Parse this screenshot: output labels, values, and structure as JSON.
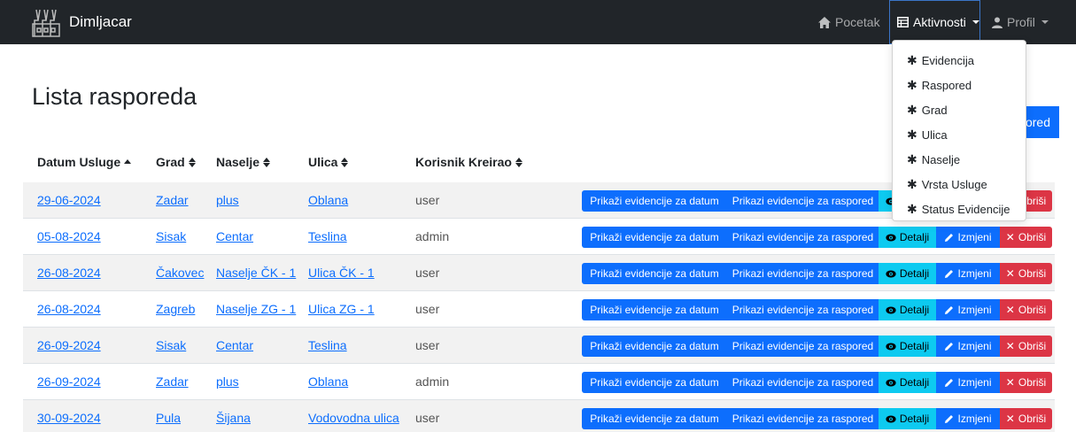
{
  "navbar": {
    "brand": "Dimljacar",
    "home_label": "Pocetak",
    "activities_label": "Aktivnosti",
    "profile_label": "Profil"
  },
  "dropdown": {
    "items": [
      {
        "icon": "asterisk-icon",
        "label": "Evidencija"
      },
      {
        "icon": "asterisk-icon",
        "label": "Raspored"
      },
      {
        "icon": "asterisk-icon",
        "label": "Grad"
      },
      {
        "icon": "asterisk-icon",
        "label": "Ulica"
      },
      {
        "icon": "asterisk-icon",
        "label": "Naselje"
      },
      {
        "icon": "asterisk-icon",
        "label": "Vrsta Usluge"
      },
      {
        "icon": "asterisk-icon",
        "label": "Status Evidencije"
      }
    ]
  },
  "page": {
    "title": "Lista rasporeda",
    "add_button_partial": "ored"
  },
  "table": {
    "headers": [
      "Datum Usluge",
      "Grad",
      "Naselje",
      "Ulica",
      "Korisnik Kreirao"
    ],
    "buttons": {
      "by_date": "Prikaži evidencije za datum",
      "by_schedule": "Prikazi evidencije za raspored",
      "details": "Detalji",
      "edit": "Izmjeni",
      "delete": "Obriši"
    },
    "rows": [
      {
        "datum": "29-06-2024",
        "grad": "Zadar",
        "naselje": "plus",
        "ulica": "Oblana",
        "korisnik": "user"
      },
      {
        "datum": "05-08-2024",
        "grad": "Sisak",
        "naselje": "Centar",
        "ulica": "Teslina",
        "korisnik": "admin"
      },
      {
        "datum": "26-08-2024",
        "grad": "Čakovec",
        "naselje": "Naselje ČK - 1",
        "ulica": "Ulica ČK - 1",
        "korisnik": "user"
      },
      {
        "datum": "26-08-2024",
        "grad": "Zagreb",
        "naselje": "Naselje ZG - 1",
        "ulica": "Ulica ZG - 1",
        "korisnik": "user"
      },
      {
        "datum": "26-09-2024",
        "grad": "Sisak",
        "naselje": "Centar",
        "ulica": "Teslina",
        "korisnik": "user"
      },
      {
        "datum": "26-09-2024",
        "grad": "Zadar",
        "naselje": "plus",
        "ulica": "Oblana",
        "korisnik": "admin"
      },
      {
        "datum": "30-09-2024",
        "grad": "Pula",
        "naselje": "Šijana",
        "ulica": "Vodovodna ulica",
        "korisnik": "user"
      }
    ]
  },
  "colors": {
    "navbar": "#212529",
    "primary": "#0d6efd",
    "info": "#0dcaf0",
    "danger": "#dc3545",
    "stripe": "#f2f2f2"
  }
}
